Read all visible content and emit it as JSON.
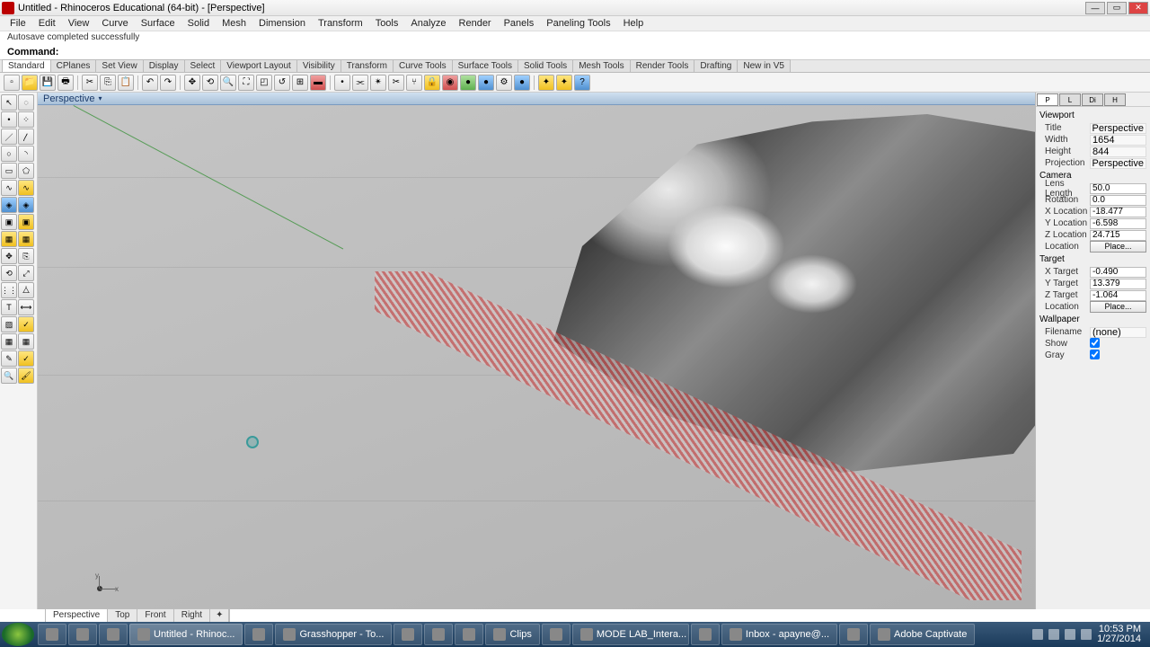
{
  "window": {
    "title": "Untitled - Rhinoceros Educational (64-bit) - [Perspective]"
  },
  "menu": [
    "File",
    "Edit",
    "View",
    "Curve",
    "Surface",
    "Solid",
    "Mesh",
    "Dimension",
    "Transform",
    "Tools",
    "Analyze",
    "Render",
    "Panels",
    "Paneling Tools",
    "Help"
  ],
  "status_message": "Autosave completed successfully",
  "command": {
    "label": "Command:",
    "value": ""
  },
  "tool_tabs": [
    "Standard",
    "CPlanes",
    "Set View",
    "Display",
    "Select",
    "Viewport Layout",
    "Visibility",
    "Transform",
    "Curve Tools",
    "Surface Tools",
    "Solid Tools",
    "Mesh Tools",
    "Render Tools",
    "Drafting",
    "New in V5"
  ],
  "viewport": {
    "label": "Perspective"
  },
  "view_tabs": [
    "Perspective",
    "Top",
    "Front",
    "Right"
  ],
  "properties": {
    "panel_tabs": [
      "P",
      "L",
      "Di",
      "H"
    ],
    "viewport_section": "Viewport",
    "title_k": "Title",
    "title_v": "Perspective",
    "width_k": "Width",
    "width_v": "1654",
    "height_k": "Height",
    "height_v": "844",
    "projection_k": "Projection",
    "projection_v": "Perspective",
    "camera_section": "Camera",
    "lens_k": "Lens Length",
    "lens_v": "50.0",
    "rotation_k": "Rotation",
    "rotation_v": "0.0",
    "xloc_k": "X Location",
    "xloc_v": "-18.477",
    "yloc_k": "Y Location",
    "yloc_v": "-6.598",
    "zloc_k": "Z Location",
    "zloc_v": "24.715",
    "loc_k": "Location",
    "loc_btn": "Place...",
    "target_section": "Target",
    "xt_k": "X Target",
    "xt_v": "-0.490",
    "yt_k": "Y Target",
    "yt_v": "13.379",
    "zt_k": "Z Target",
    "zt_v": "-1.064",
    "tloc_k": "Location",
    "tloc_btn": "Place...",
    "wall_section": "Wallpaper",
    "file_k": "Filename",
    "file_v": "(none)",
    "show_k": "Show",
    "show_v": true,
    "gray_k": "Gray",
    "gray_v": true
  },
  "taskbar": {
    "items": [
      {
        "label": ""
      },
      {
        "label": ""
      },
      {
        "label": ""
      },
      {
        "label": "Untitled - Rhinoc..."
      },
      {
        "label": ""
      },
      {
        "label": "Grasshopper - To..."
      },
      {
        "label": ""
      },
      {
        "label": ""
      },
      {
        "label": ""
      },
      {
        "label": "Clips"
      },
      {
        "label": ""
      },
      {
        "label": "MODE LAB_Intera..."
      },
      {
        "label": ""
      },
      {
        "label": "Inbox - apayne@..."
      },
      {
        "label": ""
      },
      {
        "label": "Adobe Captivate"
      }
    ],
    "time": "10:53 PM",
    "date": "1/27/2014"
  }
}
